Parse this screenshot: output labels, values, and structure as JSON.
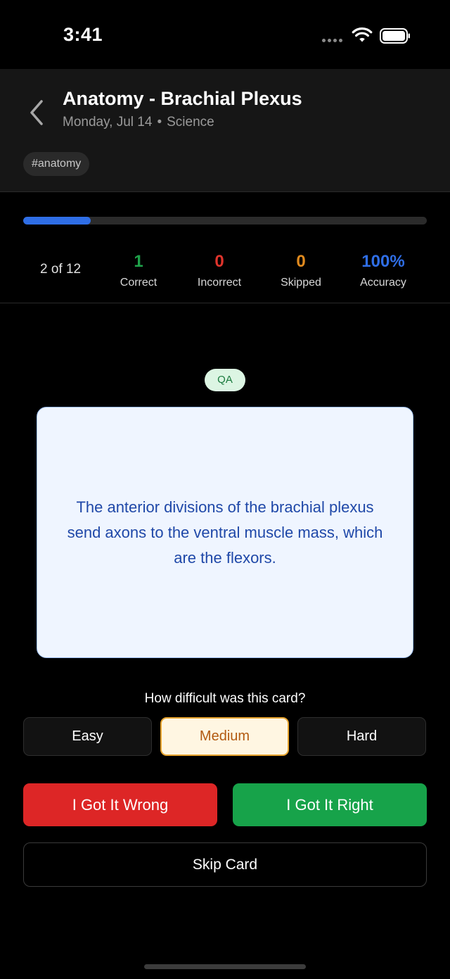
{
  "status_bar": {
    "time": "3:41"
  },
  "header": {
    "title": "Anatomy - Brachial Plexus",
    "date": "Monday, Jul 14",
    "separator": "•",
    "category": "Science",
    "tag": "#anatomy"
  },
  "progress": {
    "position_text": "2 of 12",
    "fraction": 0.167,
    "stats": [
      {
        "value": "1",
        "label": "Correct",
        "color": "#1fa24a"
      },
      {
        "value": "0",
        "label": "Incorrect",
        "color": "#e0342c"
      },
      {
        "value": "0",
        "label": "Skipped",
        "color": "#e08a1e"
      },
      {
        "value": "100%",
        "label": "Accuracy",
        "color": "#2f6ee6"
      }
    ]
  },
  "card": {
    "type_badge": "QA",
    "text": "The anterior divisions of the brachial plexus send axons to the ventral muscle mass, which are the flexors."
  },
  "difficulty": {
    "prompt": "How difficult was this card?",
    "options": [
      "Easy",
      "Medium",
      "Hard"
    ],
    "selected": "Medium"
  },
  "actions": {
    "wrong_label": "I Got It Wrong",
    "right_label": "I Got It Right",
    "skip_label": "Skip Card"
  },
  "icons": {
    "back": "chevron-left-icon",
    "wifi": "wifi-icon",
    "battery": "battery-icon"
  }
}
